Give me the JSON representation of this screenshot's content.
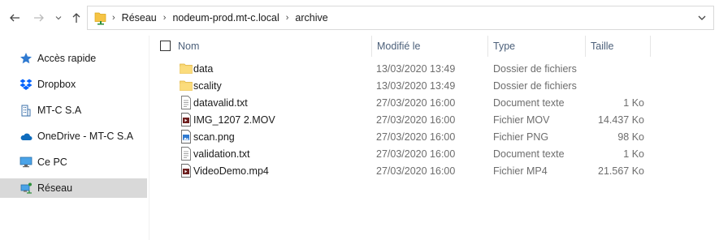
{
  "address": {
    "crumbs": [
      "Réseau",
      "nodeum-prod.mt-c.local",
      "archive"
    ]
  },
  "sidebar": {
    "items": [
      {
        "label": "Accès rapide",
        "icon": "star-icon"
      },
      {
        "label": "Dropbox",
        "icon": "dropbox-icon"
      },
      {
        "label": "MT-C S.A",
        "icon": "building-icon"
      },
      {
        "label": "OneDrive - MT-C S.A",
        "icon": "cloud-icon"
      },
      {
        "label": "Ce PC",
        "icon": "monitor-icon"
      },
      {
        "label": "Réseau",
        "icon": "network-icon",
        "selected": true
      }
    ]
  },
  "columns": {
    "name": "Nom",
    "modified": "Modifié le",
    "type": "Type",
    "size": "Taille"
  },
  "files": [
    {
      "name": "data",
      "modified": "13/03/2020 13:49",
      "type": "Dossier de fichiers",
      "size": "",
      "icon": "folder-icon"
    },
    {
      "name": "scality",
      "modified": "13/03/2020 13:49",
      "type": "Dossier de fichiers",
      "size": "",
      "icon": "folder-icon"
    },
    {
      "name": "datavalid.txt",
      "modified": "27/03/2020 16:00",
      "type": "Document texte",
      "size": "1 Ko",
      "icon": "text-file-icon"
    },
    {
      "name": "IMG_1207 2.MOV",
      "modified": "27/03/2020 16:00",
      "type": "Fichier MOV",
      "size": "14.437 Ko",
      "icon": "video-file-icon"
    },
    {
      "name": "scan.png",
      "modified": "27/03/2020 16:00",
      "type": "Fichier PNG",
      "size": "98 Ko",
      "icon": "image-file-icon"
    },
    {
      "name": "validation.txt",
      "modified": "27/03/2020 16:00",
      "type": "Document texte",
      "size": "1 Ko",
      "icon": "text-file-icon"
    },
    {
      "name": "VideoDemo.mp4",
      "modified": "27/03/2020 16:00",
      "type": "Fichier MP4",
      "size": "21.567 Ko",
      "icon": "video-file-icon"
    }
  ]
}
